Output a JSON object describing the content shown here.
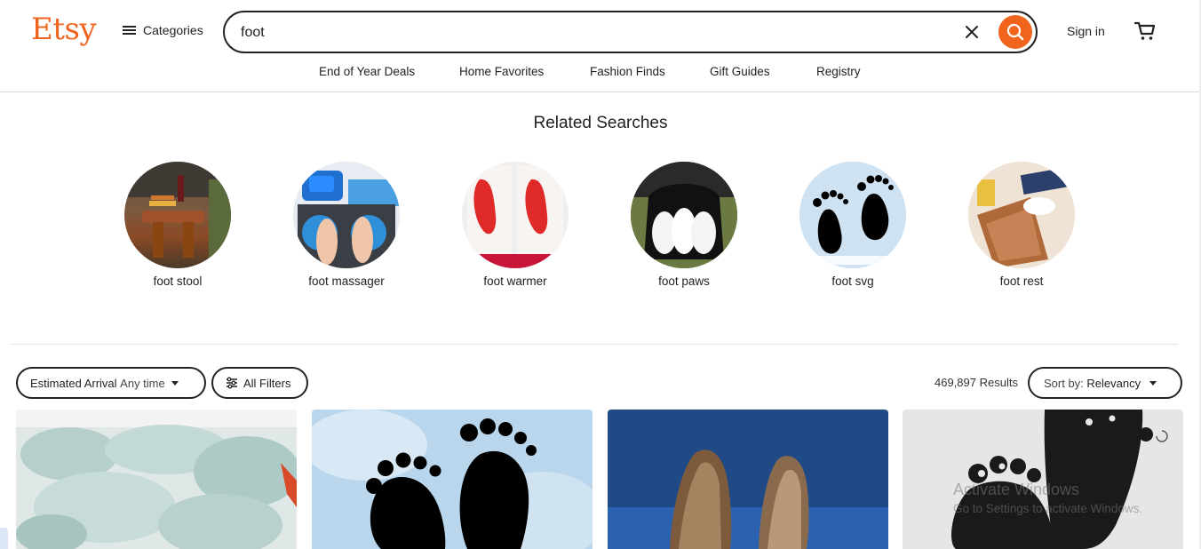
{
  "header": {
    "logo": "Etsy",
    "categories_label": "Categories",
    "search_value": "foot",
    "signin_label": "Sign in"
  },
  "nav": [
    "End of Year Deals",
    "Home Favorites",
    "Fashion Finds",
    "Gift Guides",
    "Registry"
  ],
  "related": {
    "title": "Related Searches",
    "items": [
      {
        "label": "foot stool"
      },
      {
        "label": "foot massager"
      },
      {
        "label": "foot warmer"
      },
      {
        "label": "foot paws"
      },
      {
        "label": "foot svg"
      },
      {
        "label": "foot rest"
      }
    ]
  },
  "filters": {
    "arrival_label": "Estimated Arrival",
    "arrival_value": "Any time",
    "all_filters_label": "All Filters",
    "results_text": "469,897 Results",
    "sort_label": "Sort by:",
    "sort_value": "Relevancy"
  },
  "watermark": {
    "line1": "Activate Windows",
    "line2": "Go to Settings to activate Windows."
  },
  "colors": {
    "brand": "#f1641e",
    "text": "#222222"
  }
}
